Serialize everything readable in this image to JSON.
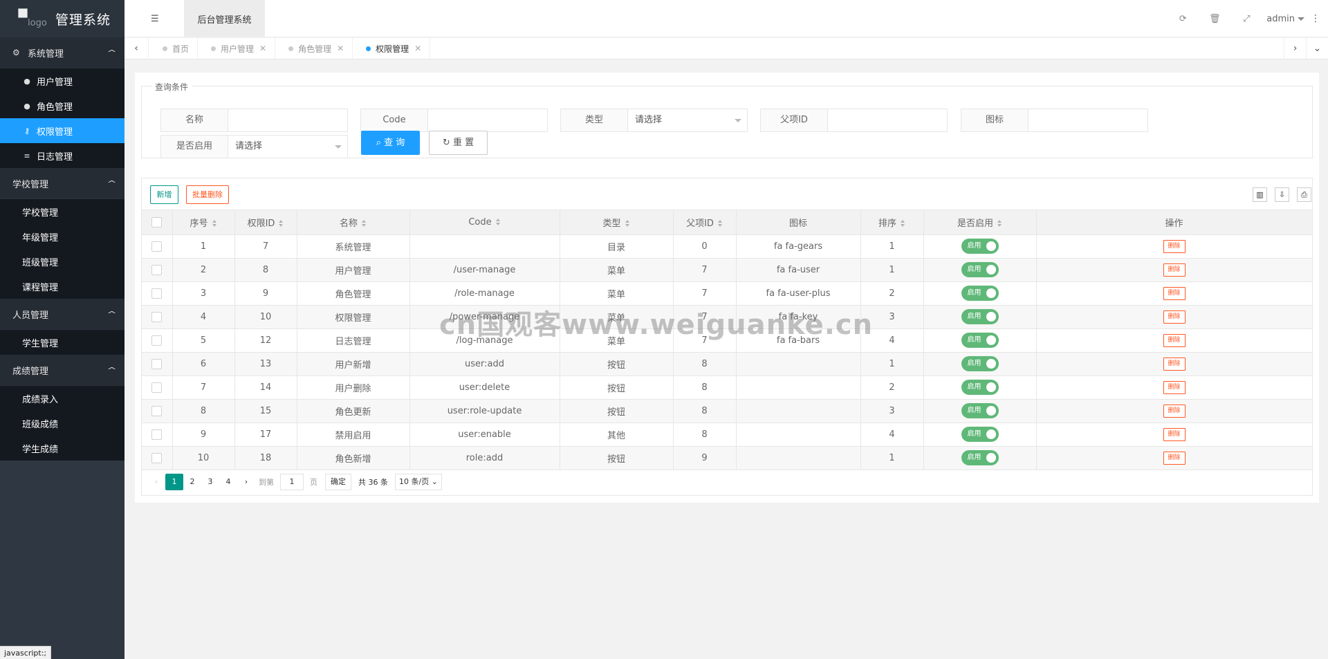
{
  "app": {
    "logo_alt": "logo",
    "title": "管理系统"
  },
  "header": {
    "tab_label": "后台管理系统",
    "user": "admin"
  },
  "sidebar": {
    "groups": [
      {
        "label": "系统管理",
        "items": [
          {
            "label": "用户管理",
            "active": false
          },
          {
            "label": "角色管理",
            "active": false
          },
          {
            "label": "权限管理",
            "active": true
          },
          {
            "label": "日志管理",
            "active": false
          }
        ]
      },
      {
        "label": "学校管理",
        "items": [
          {
            "label": "学校管理"
          },
          {
            "label": "年级管理"
          },
          {
            "label": "班级管理"
          },
          {
            "label": "课程管理"
          }
        ]
      },
      {
        "label": "人员管理",
        "items": [
          {
            "label": "学生管理"
          }
        ]
      },
      {
        "label": "成绩管理",
        "items": [
          {
            "label": "成绩录入"
          },
          {
            "label": "班级成绩"
          },
          {
            "label": "学生成绩"
          }
        ]
      }
    ]
  },
  "tabs": [
    {
      "label": "首页",
      "closable": false
    },
    {
      "label": "用户管理",
      "closable": true
    },
    {
      "label": "角色管理",
      "closable": true
    },
    {
      "label": "权限管理",
      "closable": true,
      "active": true
    }
  ],
  "search": {
    "legend": "查询条件",
    "fields": {
      "name": {
        "label": "名称",
        "value": ""
      },
      "code": {
        "label": "Code",
        "value": ""
      },
      "type": {
        "label": "类型",
        "value": "请选择"
      },
      "parent": {
        "label": "父项ID",
        "value": ""
      },
      "icon": {
        "label": "图标",
        "value": ""
      },
      "enabled": {
        "label": "是否启用",
        "value": "请选择"
      }
    },
    "query_label": "查 询",
    "reset_label": "重 置"
  },
  "toolbar": {
    "add_label": "新增",
    "batch_delete_label": "批量删除"
  },
  "table": {
    "headers": [
      "序号",
      "权限ID",
      "名称",
      "Code",
      "类型",
      "父项ID",
      "图标",
      "排序",
      "是否启用",
      "操作"
    ],
    "switch_label": "启用",
    "delete_label": "删除",
    "rows": [
      {
        "no": "1",
        "id": "7",
        "name": "系统管理",
        "code": "",
        "type": "目录",
        "parent": "0",
        "icon": "fa fa-gears",
        "sort": "1"
      },
      {
        "no": "2",
        "id": "8",
        "name": "用户管理",
        "code": "/user-manage",
        "type": "菜单",
        "parent": "7",
        "icon": "fa fa-user",
        "sort": "1"
      },
      {
        "no": "3",
        "id": "9",
        "name": "角色管理",
        "code": "/role-manage",
        "type": "菜单",
        "parent": "7",
        "icon": "fa fa-user-plus",
        "sort": "2"
      },
      {
        "no": "4",
        "id": "10",
        "name": "权限管理",
        "code": "/power-manage",
        "type": "菜单",
        "parent": "7",
        "icon": "fa fa-key",
        "sort": "3"
      },
      {
        "no": "5",
        "id": "12",
        "name": "日志管理",
        "code": "/log-manage",
        "type": "菜单",
        "parent": "7",
        "icon": "fa fa-bars",
        "sort": "4"
      },
      {
        "no": "6",
        "id": "13",
        "name": "用户新增",
        "code": "user:add",
        "type": "按钮",
        "parent": "8",
        "icon": "",
        "sort": "1"
      },
      {
        "no": "7",
        "id": "14",
        "name": "用户删除",
        "code": "user:delete",
        "type": "按钮",
        "parent": "8",
        "icon": "",
        "sort": "2"
      },
      {
        "no": "8",
        "id": "15",
        "name": "角色更新",
        "code": "user:role-update",
        "type": "按钮",
        "parent": "8",
        "icon": "",
        "sort": "3"
      },
      {
        "no": "9",
        "id": "17",
        "name": "禁用启用",
        "code": "user:enable",
        "type": "其他",
        "parent": "8",
        "icon": "",
        "sort": "4"
      },
      {
        "no": "10",
        "id": "18",
        "name": "角色新增",
        "code": "role:add",
        "type": "按钮",
        "parent": "9",
        "icon": "",
        "sort": "1"
      }
    ]
  },
  "pagination": {
    "pages": [
      "1",
      "2",
      "3",
      "4"
    ],
    "current": "1",
    "goto_prefix": "到第",
    "goto_value": "1",
    "goto_suffix": "页",
    "confirm_label": "确定",
    "total": "共 36 条",
    "page_size": "10 条/页"
  },
  "watermark": "cn国观客www.weiguanke.cn",
  "status_bar": "javascript:;"
}
